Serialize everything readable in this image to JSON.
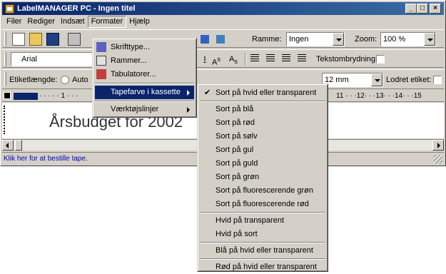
{
  "window": {
    "title": "LabelMANAGER PC - Ingen titel"
  },
  "menubar": [
    "Filer",
    "Rediger",
    "Indsæt",
    "Formater",
    "Hjælp"
  ],
  "toolbar": {
    "frame_label": "Ramme:",
    "frame_value": "Ingen",
    "zoom_label": "Zoom:",
    "zoom_value": "100 %",
    "font_value": "Arial",
    "wrap_label": "Tekstombrydning:",
    "label_length_label": "Etiketlængde:",
    "label_length_option": "Auto",
    "tape_width_value": "12 mm",
    "vertical_label": "Lodret etiket:"
  },
  "ruler": {
    "left_ticks": "· · · · · 1 · · ·",
    "right_ticks": "11 · · ·12· · ·13· · ·14· · ·15"
  },
  "document": {
    "label_text": "Årsbudget for 2002"
  },
  "status": {
    "text": "Klik her for at bestille tape."
  },
  "formater_menu": {
    "items": [
      "Skrifttype...",
      "Rammer...",
      "Tabulatorer...",
      "Tapefarve i kassette",
      "Værktøjslinjer"
    ]
  },
  "tape_menu": {
    "items": [
      "Sort på hvid eller transparent",
      "Sort på blå",
      "Sort på rød",
      "Sort på sølv",
      "Sort på gul",
      "Sort på guld",
      "Sort på grøn",
      "Sort på fluorescerende grøn",
      "Sort på fluorescerende rød",
      "Hvid på transparent",
      "Hvid på sort",
      "Blå på hvid eller transparent",
      "Rød på hvid eller transparent"
    ],
    "checked_index": 0
  }
}
